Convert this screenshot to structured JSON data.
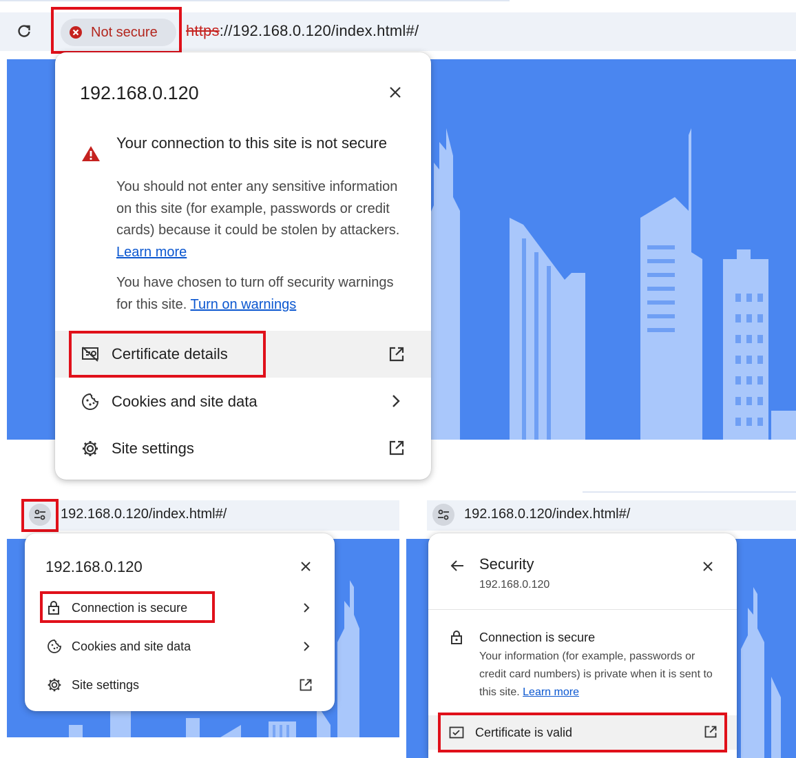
{
  "panel1": {
    "reload_icon": "reload-icon",
    "chip_label": "Not secure",
    "url_scheme": "https",
    "url_rest": "://192.168.0.120/index.html#/",
    "popup": {
      "title": "192.168.0.120",
      "warning_heading": "Your connection to this site is not secure",
      "warning_body": "You should not enter any sensitive information on this site (for example, passwords or credit cards) because it could be stolen by attackers.",
      "learn_more": "Learn more",
      "chosen_text": "You have chosen to turn off security warnings for this site.",
      "turn_on_warnings": "Turn on warnings",
      "items": [
        {
          "label": "Certificate details",
          "icon": "certificate-error-icon",
          "trailing": "external-link-icon"
        },
        {
          "label": "Cookies and site data",
          "icon": "cookie-icon",
          "trailing": "chevron-right-icon"
        },
        {
          "label": "Site settings",
          "icon": "gear-icon",
          "trailing": "external-link-icon"
        }
      ]
    }
  },
  "panel2": {
    "url": "192.168.0.120/index.html#/",
    "popup": {
      "title": "192.168.0.120",
      "items": [
        {
          "label": "Connection is secure",
          "icon": "lock-icon",
          "trailing": "chevron-right-icon"
        },
        {
          "label": "Cookies and site data",
          "icon": "cookie-icon",
          "trailing": "chevron-right-icon"
        },
        {
          "label": "Site settings",
          "icon": "gear-icon",
          "trailing": "external-link-icon"
        }
      ]
    }
  },
  "panel3": {
    "url": "192.168.0.120/index.html#/",
    "popup": {
      "title": "Security",
      "subtitle": "192.168.0.120",
      "conn_heading": "Connection is secure",
      "conn_body": "Your information (for example, passwords or credit card numbers) is private when it is sent to this site.",
      "learn_more": "Learn more",
      "cert_label": "Certificate is valid"
    }
  },
  "colors": {
    "accent_red": "#e0101a",
    "page_blue": "#4a86f0",
    "building": "#a9c7fb",
    "link": "#0b57d0"
  }
}
